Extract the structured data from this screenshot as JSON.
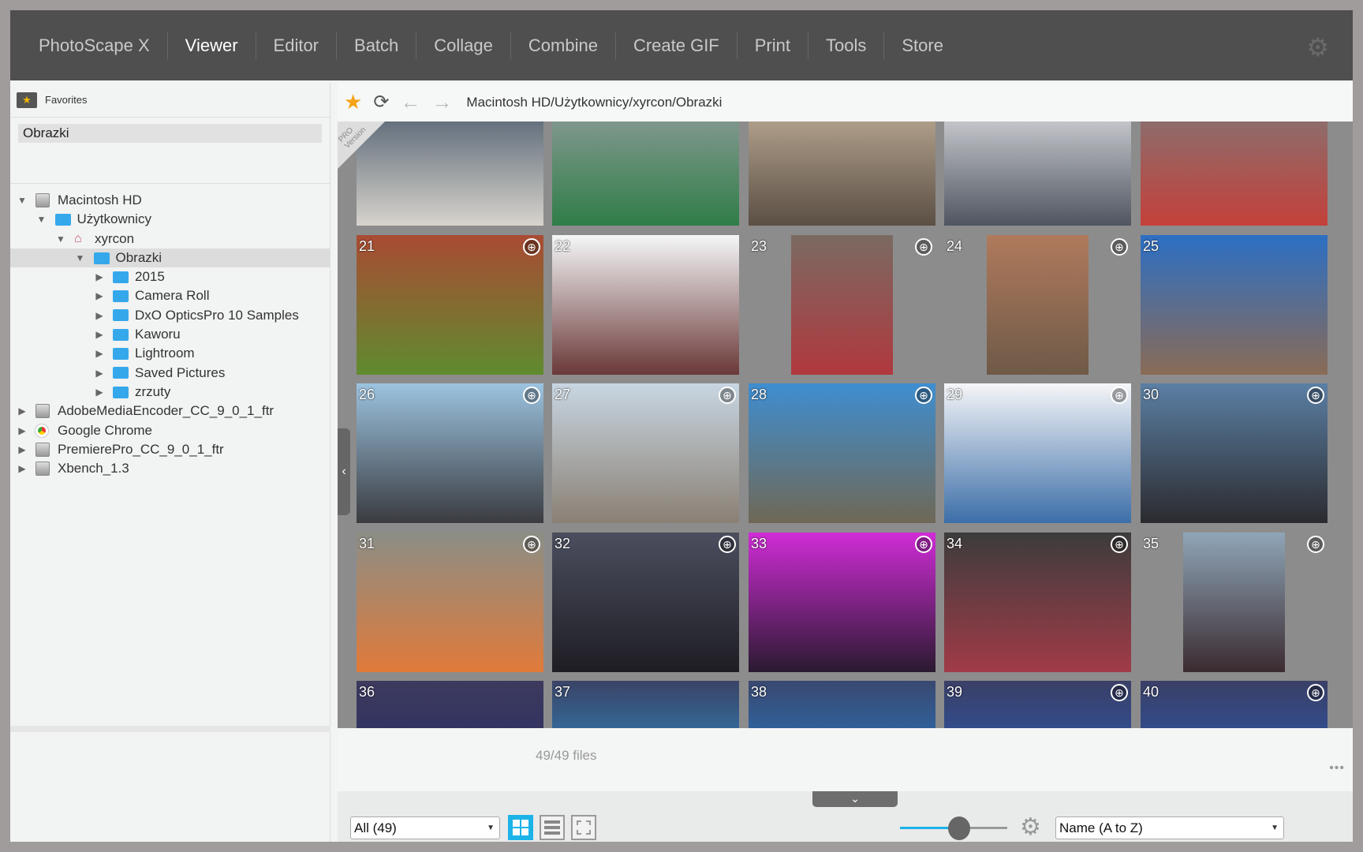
{
  "nav": {
    "items": [
      "PhotoScape X",
      "Viewer",
      "Editor",
      "Batch",
      "Collage",
      "Combine",
      "Create GIF",
      "Print",
      "Tools",
      "Store"
    ],
    "active": "Viewer"
  },
  "favorites": {
    "title": "Favorites",
    "items": [
      "Obrazki"
    ]
  },
  "tree": [
    {
      "label": "Macintosh HD",
      "level": 0,
      "icon": "drive",
      "expanded": true
    },
    {
      "label": "Użytkownicy",
      "level": 1,
      "icon": "folder",
      "expanded": true
    },
    {
      "label": "xyrcon",
      "level": 2,
      "icon": "home",
      "expanded": true
    },
    {
      "label": "Obrazki",
      "level": 3,
      "icon": "folder",
      "expanded": true,
      "selected": true
    },
    {
      "label": "2015",
      "level": 4,
      "icon": "folder"
    },
    {
      "label": "Camera Roll",
      "level": 4,
      "icon": "folder"
    },
    {
      "label": "DxO OpticsPro 10 Samples",
      "level": 4,
      "icon": "folder"
    },
    {
      "label": "Kaworu",
      "level": 4,
      "icon": "folder"
    },
    {
      "label": "Lightroom",
      "level": 4,
      "icon": "folder"
    },
    {
      "label": "Saved Pictures",
      "level": 4,
      "icon": "folder"
    },
    {
      "label": "zrzuty",
      "level": 4,
      "icon": "folder"
    },
    {
      "label": "AdobeMediaEncoder_CC_9_0_1_ftr",
      "level": 0,
      "icon": "drive"
    },
    {
      "label": "Google Chrome",
      "level": 0,
      "icon": "chrome"
    },
    {
      "label": "PremierePro_CC_9_0_1_ftr",
      "level": 0,
      "icon": "drive"
    },
    {
      "label": "Xbench_1.3",
      "level": 0,
      "icon": "drive"
    }
  ],
  "path": "Macintosh HD/Użytkownicy/xyrcon/Obrazki",
  "pro_badge": "PRO Version",
  "thumbnails": [
    {
      "num": "",
      "globe": false,
      "colors": [
        "#3d4f63",
        "#d7d3cc"
      ]
    },
    {
      "num": "",
      "globe": false,
      "colors": [
        "#9aa0a3",
        "#2f7d47"
      ]
    },
    {
      "num": "",
      "globe": false,
      "colors": [
        "#c9b7a0",
        "#5b4f44"
      ]
    },
    {
      "num": "",
      "globe": false,
      "colors": [
        "#e9eaed",
        "#4f5560"
      ]
    },
    {
      "num": "",
      "globe": false,
      "colors": [
        "#7b7b7b",
        "#c4403a"
      ]
    },
    {
      "num": "21",
      "globe": true,
      "colors": [
        "#a94b33",
        "#5f8b2f"
      ]
    },
    {
      "num": "22",
      "globe": false,
      "colors": [
        "#f5f7f8",
        "#6b3838"
      ]
    },
    {
      "num": "23",
      "globe": true,
      "portrait": true,
      "colors": [
        "#7a6a62",
        "#b0383e"
      ]
    },
    {
      "num": "24",
      "globe": true,
      "portrait": true,
      "colors": [
        "#b07a5c",
        "#6e5a48"
      ]
    },
    {
      "num": "25",
      "globe": false,
      "colors": [
        "#2c6fc4",
        "#8a6b56"
      ]
    },
    {
      "num": "26",
      "globe": true,
      "colors": [
        "#9cc3e0",
        "#3a3b3f"
      ]
    },
    {
      "num": "27",
      "globe": true,
      "colors": [
        "#c8d6e2",
        "#8a8074"
      ]
    },
    {
      "num": "28",
      "globe": true,
      "colors": [
        "#3f8ed0",
        "#6f6856"
      ]
    },
    {
      "num": "29",
      "globe": true,
      "colors": [
        "#f5f6f8",
        "#3c6ea8"
      ]
    },
    {
      "num": "30",
      "globe": true,
      "colors": [
        "#5b7fa4",
        "#2b2b2f"
      ]
    },
    {
      "num": "31",
      "globe": true,
      "colors": [
        "#8b8e86",
        "#e07a3a"
      ]
    },
    {
      "num": "32",
      "globe": true,
      "colors": [
        "#4b4e5e",
        "#1e1d24"
      ]
    },
    {
      "num": "33",
      "globe": true,
      "colors": [
        "#d02cd6",
        "#2a1a30"
      ]
    },
    {
      "num": "34",
      "globe": true,
      "colors": [
        "#3c3c3c",
        "#a13b48"
      ]
    },
    {
      "num": "35",
      "globe": true,
      "portrait": true,
      "colors": [
        "#8fa6b8",
        "#3b2b30"
      ]
    },
    {
      "num": "36",
      "globe": false,
      "colors": [
        "#3d3a5e",
        "#1f2a66"
      ]
    },
    {
      "num": "37",
      "globe": false,
      "colors": [
        "#3a4466",
        "#2aa8f0"
      ]
    },
    {
      "num": "38",
      "globe": false,
      "colors": [
        "#394870",
        "#1f8fe8"
      ]
    },
    {
      "num": "39",
      "globe": true,
      "colors": [
        "#3a3f66",
        "#2563d0"
      ]
    },
    {
      "num": "40",
      "globe": true,
      "colors": [
        "#3a3f66",
        "#2563d0"
      ]
    }
  ],
  "status": {
    "count": "49/49 files",
    "more": "•••"
  },
  "bottom": {
    "filter": "All (49)",
    "sort": "Name (A to Z)",
    "zoom_level": 0.55,
    "view_mode": "grid"
  },
  "colors": {
    "accent": "#1cb3e8",
    "star": "#f5a418"
  }
}
